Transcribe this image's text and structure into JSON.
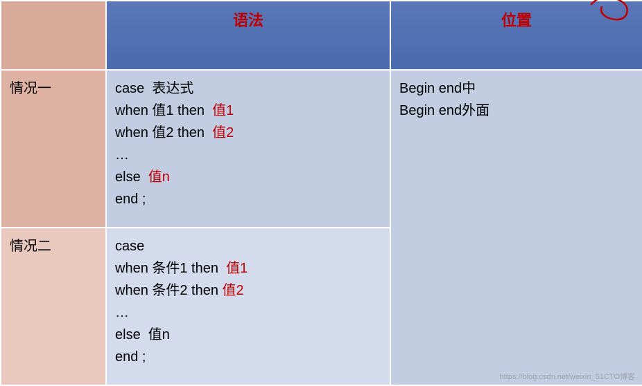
{
  "headers": {
    "blank": "",
    "syntax": "语法",
    "position": "位置"
  },
  "rows": [
    {
      "label": "情况一",
      "syntax": {
        "l1a": "case  表达式",
        "l2a": "when 值1 then  ",
        "l2b": "值1",
        "l3a": "when 值2 then  ",
        "l3b": "值2",
        "l4a": "…",
        "l5a": "else  ",
        "l5b": "值n",
        "l6a": "end ;"
      }
    },
    {
      "label": "情况二",
      "syntax": {
        "l1a": "case",
        "l2a": "when 条件1 then  ",
        "l2b": "值1",
        "l3a": "when 条件2 then ",
        "l3b": "值2",
        "l4a": "…",
        "l5a": "else  值n",
        "l6a": "end ;"
      }
    }
  ],
  "position": {
    "line1": "Begin end中",
    "line2": "Begin end外面"
  },
  "watermark": "https://blog.csdn.net/weixin_51CTO博客"
}
